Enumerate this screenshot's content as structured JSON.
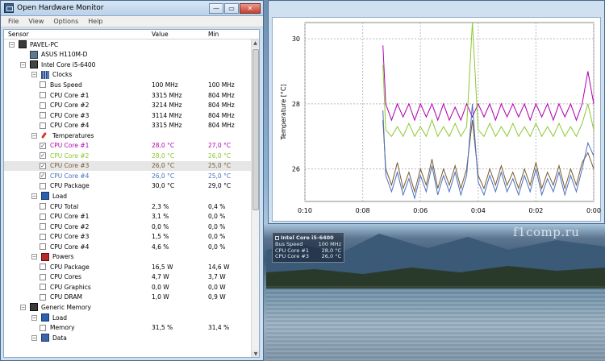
{
  "window": {
    "title": "Open Hardware Monitor",
    "minimize": "—",
    "maximize": "▭",
    "close": "✕"
  },
  "menu": [
    "File",
    "View",
    "Options",
    "Help"
  ],
  "columns": {
    "sensor": "Sensor",
    "value": "Value",
    "min": "Min"
  },
  "tree": [
    {
      "level": 0,
      "expand": "−",
      "icon": "pc",
      "label": "PAVEL-PC"
    },
    {
      "level": 1,
      "expand": "",
      "icon": "board",
      "label": "ASUS H110M-D"
    },
    {
      "level": 1,
      "expand": "−",
      "icon": "cpu",
      "label": "Intel Core i5-6400"
    },
    {
      "level": 2,
      "expand": "−",
      "icon": "clock",
      "label": "Clocks"
    },
    {
      "level": 3,
      "check": false,
      "label": "Bus Speed",
      "value": "100 MHz",
      "min": "100 MHz"
    },
    {
      "level": 3,
      "check": false,
      "label": "CPU Core #1",
      "value": "3315 MHz",
      "min": "804 MHz"
    },
    {
      "level": 3,
      "check": false,
      "label": "CPU Core #2",
      "value": "3214 MHz",
      "min": "804 MHz"
    },
    {
      "level": 3,
      "check": false,
      "label": "CPU Core #3",
      "value": "3114 MHz",
      "min": "804 MHz"
    },
    {
      "level": 3,
      "check": false,
      "label": "CPU Core #4",
      "value": "3315 MHz",
      "min": "804 MHz"
    },
    {
      "level": 2,
      "expand": "−",
      "icon": "temp",
      "label": "Temperatures"
    },
    {
      "level": 3,
      "check": true,
      "label": "CPU Core #1",
      "value": "28,0 °C",
      "min": "27,0 °C",
      "color": "#b000b0"
    },
    {
      "level": 3,
      "check": true,
      "label": "CPU Core #2",
      "value": "28,0 °C",
      "min": "26,0 °C",
      "color": "#8cc830"
    },
    {
      "level": 3,
      "check": true,
      "label": "CPU Core #3",
      "value": "26,0 °C",
      "min": "25,0 °C",
      "color": "#7a5a30",
      "highlight": true
    },
    {
      "level": 3,
      "check": true,
      "label": "CPU Core #4",
      "value": "26,0 °C",
      "min": "25,0 °C",
      "color": "#4a70c0"
    },
    {
      "level": 3,
      "check": false,
      "label": "CPU Package",
      "value": "30,0 °C",
      "min": "29,0 °C"
    },
    {
      "level": 2,
      "expand": "−",
      "icon": "load",
      "label": "Load"
    },
    {
      "level": 3,
      "check": false,
      "label": "CPU Total",
      "value": "2,3 %",
      "min": "0,4 %"
    },
    {
      "level": 3,
      "check": false,
      "label": "CPU Core #1",
      "value": "3,1 %",
      "min": "0,0 %"
    },
    {
      "level": 3,
      "check": false,
      "label": "CPU Core #2",
      "value": "0,0 %",
      "min": "0,0 %"
    },
    {
      "level": 3,
      "check": false,
      "label": "CPU Core #3",
      "value": "1,5 %",
      "min": "0,0 %"
    },
    {
      "level": 3,
      "check": false,
      "label": "CPU Core #4",
      "value": "4,6 %",
      "min": "0,0 %"
    },
    {
      "level": 2,
      "expand": "−",
      "icon": "power",
      "label": "Powers"
    },
    {
      "level": 3,
      "check": false,
      "label": "CPU Package",
      "value": "16,5 W",
      "min": "14,6 W"
    },
    {
      "level": 3,
      "check": false,
      "label": "CPU Cores",
      "value": "4,7 W",
      "min": "3,7 W"
    },
    {
      "level": 3,
      "check": false,
      "label": "CPU Graphics",
      "value": "0,0 W",
      "min": "0,0 W"
    },
    {
      "level": 3,
      "check": false,
      "label": "CPU DRAM",
      "value": "1,0 W",
      "min": "0,9 W"
    },
    {
      "level": 1,
      "expand": "−",
      "icon": "mem",
      "label": "Generic Memory"
    },
    {
      "level": 2,
      "expand": "−",
      "icon": "load",
      "label": "Load"
    },
    {
      "level": 3,
      "check": false,
      "label": "Memory",
      "value": "31,5 %",
      "min": "31,4 %"
    },
    {
      "level": 2,
      "expand": "−",
      "icon": "data",
      "label": "Data"
    }
  ],
  "plot": {
    "ylabel": "Temperature [°C]",
    "yticks": [
      "30",
      "28",
      "26"
    ],
    "xticks": [
      "0:10",
      "0:08",
      "0:06",
      "0:04",
      "0:02",
      "0:00"
    ]
  },
  "gadget": {
    "title": "Intel Core i5-6400",
    "rows": [
      {
        "label": "Bus Speed",
        "value": "100 MHz"
      },
      {
        "label": "CPU Core #1",
        "value": "28,0 °C"
      },
      {
        "label": "CPU Core #3",
        "value": "26,0 °C"
      }
    ]
  },
  "watermark": "f1comp.ru",
  "chart_data": {
    "type": "line",
    "ylabel": "Temperature [°C]",
    "xlabel": "",
    "ylim": [
      25,
      30.5
    ],
    "x_ticks": [
      "0:10",
      "0:08",
      "0:06",
      "0:04",
      "0:02",
      "0:00"
    ],
    "series": [
      {
        "name": "CPU Core #1",
        "color": "#b000b0",
        "x": [
          7.3,
          7.2,
          7.0,
          6.8,
          6.6,
          6.4,
          6.2,
          6.0,
          5.8,
          5.6,
          5.4,
          5.2,
          5.0,
          4.8,
          4.6,
          4.4,
          4.2,
          4.0,
          3.8,
          3.6,
          3.4,
          3.2,
          3.0,
          2.8,
          2.6,
          2.4,
          2.2,
          2.0,
          1.8,
          1.6,
          1.4,
          1.2,
          1.0,
          0.8,
          0.6,
          0.4,
          0.2,
          0.0
        ],
        "y": [
          29.8,
          28.0,
          27.5,
          28.0,
          27.6,
          28.0,
          27.5,
          28.0,
          27.6,
          28.0,
          27.5,
          28.0,
          27.5,
          27.9,
          27.5,
          28.0,
          27.6,
          28.0,
          27.6,
          28.0,
          27.5,
          28.0,
          27.6,
          28.0,
          27.6,
          28.0,
          27.5,
          28.0,
          27.6,
          28.0,
          27.5,
          28.0,
          27.6,
          28.0,
          27.5,
          28.0,
          29.0,
          28.0
        ]
      },
      {
        "name": "CPU Core #2",
        "color": "#8cc830",
        "x": [
          7.3,
          7.2,
          7.0,
          6.8,
          6.6,
          6.4,
          6.2,
          6.0,
          5.8,
          5.6,
          5.4,
          5.2,
          5.0,
          4.8,
          4.6,
          4.4,
          4.2,
          4.0,
          3.8,
          3.6,
          3.4,
          3.2,
          3.0,
          2.8,
          2.6,
          2.4,
          2.2,
          2.0,
          1.8,
          1.6,
          1.4,
          1.2,
          1.0,
          0.8,
          0.6,
          0.4,
          0.2,
          0.0
        ],
        "y": [
          29.2,
          27.2,
          27.0,
          27.3,
          27.0,
          27.4,
          27.0,
          27.3,
          27.0,
          27.5,
          27.0,
          27.3,
          27.0,
          27.4,
          27.0,
          27.3,
          30.5,
          27.2,
          27.0,
          27.4,
          27.0,
          27.3,
          27.0,
          27.4,
          27.0,
          27.3,
          27.0,
          27.4,
          27.0,
          27.3,
          27.0,
          27.4,
          27.0,
          27.3,
          27.0,
          27.4,
          28.0,
          27.2
        ]
      },
      {
        "name": "CPU Core #3",
        "color": "#7a5a30",
        "x": [
          7.3,
          7.2,
          7.0,
          6.8,
          6.6,
          6.4,
          6.2,
          6.0,
          5.8,
          5.6,
          5.4,
          5.2,
          5.0,
          4.8,
          4.6,
          4.4,
          4.2,
          4.0,
          3.8,
          3.6,
          3.4,
          3.2,
          3.0,
          2.8,
          2.6,
          2.4,
          2.2,
          2.0,
          1.8,
          1.6,
          1.4,
          1.2,
          1.0,
          0.8,
          0.6,
          0.4,
          0.2,
          0.0
        ],
        "y": [
          27.5,
          26.0,
          25.5,
          26.2,
          25.4,
          25.9,
          25.3,
          26.0,
          25.5,
          26.3,
          25.4,
          26.0,
          25.5,
          26.1,
          25.4,
          26.0,
          27.5,
          25.8,
          25.4,
          26.0,
          25.5,
          26.1,
          25.5,
          25.9,
          25.4,
          26.0,
          25.5,
          26.2,
          25.4,
          25.9,
          25.5,
          26.1,
          25.4,
          26.0,
          25.5,
          26.2,
          26.5,
          26.0
        ]
      },
      {
        "name": "CPU Core #4",
        "color": "#4a70c0",
        "x": [
          7.3,
          7.2,
          7.0,
          6.8,
          6.6,
          6.4,
          6.2,
          6.0,
          5.8,
          5.6,
          5.4,
          5.2,
          5.0,
          4.8,
          4.6,
          4.4,
          4.2,
          4.0,
          3.8,
          3.6,
          3.4,
          3.2,
          3.0,
          2.8,
          2.6,
          2.4,
          2.2,
          2.0,
          1.8,
          1.6,
          1.4,
          1.2,
          1.0,
          0.8,
          0.6,
          0.4,
          0.2,
          0.0
        ],
        "y": [
          27.8,
          25.8,
          25.3,
          25.9,
          25.2,
          25.7,
          25.1,
          25.8,
          25.3,
          26.1,
          25.2,
          25.8,
          25.3,
          25.9,
          25.2,
          25.8,
          28.0,
          25.6,
          25.2,
          25.8,
          25.3,
          25.9,
          25.3,
          25.7,
          25.2,
          25.8,
          25.3,
          26.0,
          25.2,
          25.7,
          25.3,
          25.9,
          25.2,
          25.8,
          25.3,
          26.0,
          26.8,
          26.4
        ]
      }
    ]
  }
}
